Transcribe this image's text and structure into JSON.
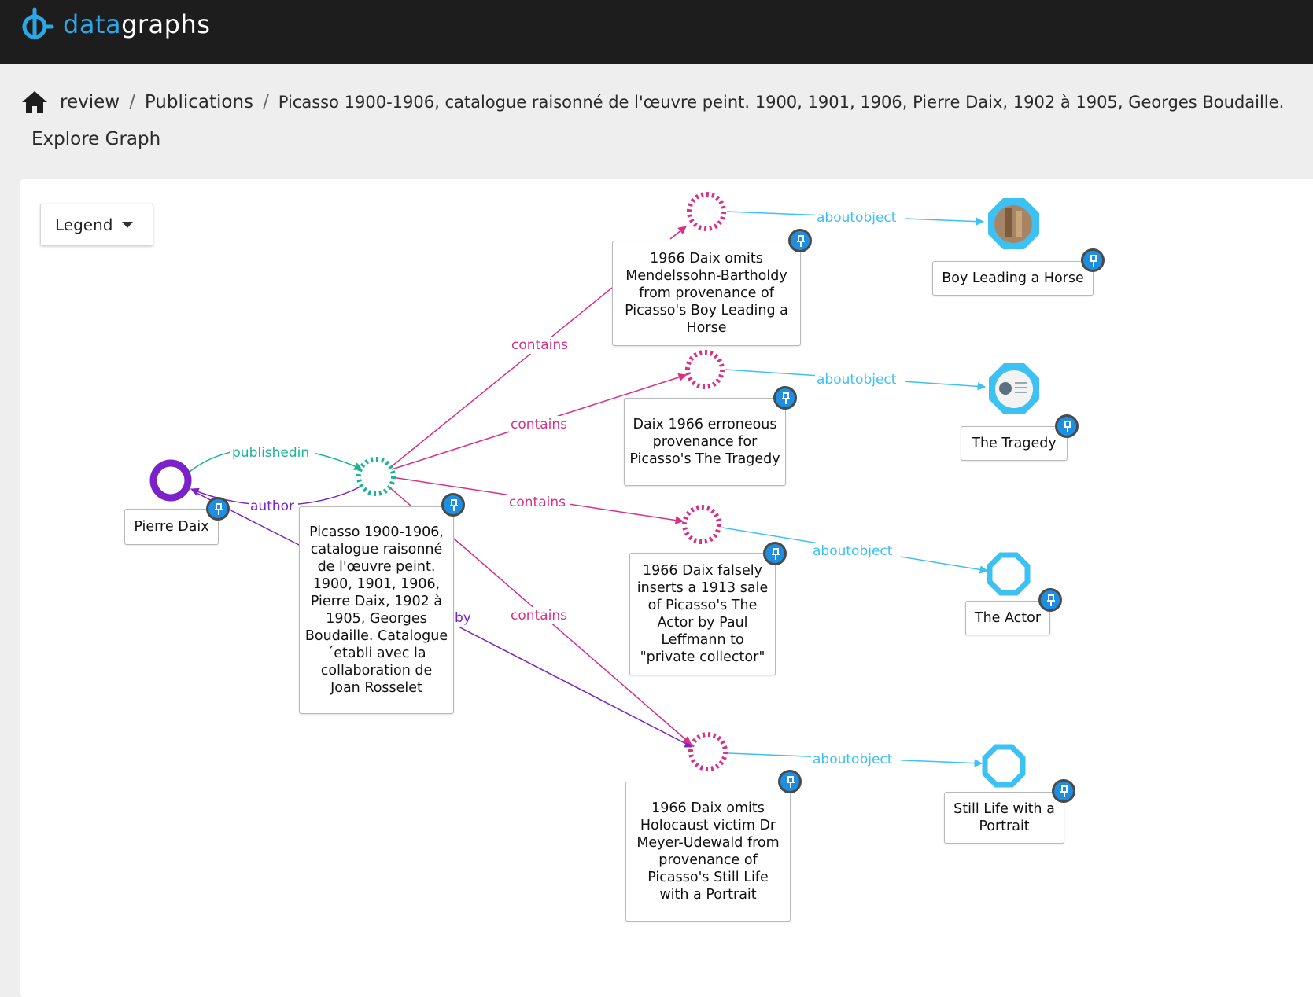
{
  "app": {
    "brand_part1": "data",
    "brand_part2": "graphs"
  },
  "breadcrumb": {
    "items": [
      "review",
      "Publications"
    ],
    "separator": "/",
    "current": "Picasso 1900-1906, catalogue raisonné de l'œuvre peint. 1900, 1901, 1906, Pierre Daix, 1902 à 1905, Georges Boudaille."
  },
  "page": {
    "subtitle": "Explore Graph"
  },
  "legend": {
    "label": "Legend"
  },
  "colors": {
    "contains": "#d92f86",
    "aboutobject": "#3dc1f2",
    "publishedin": "#1ab394",
    "author": "#7a21c9",
    "pin": "#1e8fe0"
  },
  "graph": {
    "nodes": {
      "pierre": {
        "label": "Pierre Daix"
      },
      "publication": {
        "label": "Picasso 1900-1906, catalogue raisonné de l'œuvre peint. 1900, 1901, 1906, Pierre Daix, 1902 à 1905, Georges Boudaille. Catalogue´etabli avec la collaboration de Joan Rosselet"
      },
      "claim1": {
        "label": "1966 Daix omits Mendelssohn-Bartholdy from provenance of Picasso's Boy Leading a Horse"
      },
      "claim2": {
        "label": "Daix 1966 erroneous provenance for Picasso's The Tragedy"
      },
      "claim3": {
        "label": "1966 Daix falsely inserts a 1913 sale of Picasso's The Actor by Paul Leffmann to \"private collector\""
      },
      "claim4": {
        "label": "1966 Daix omits Holocaust victim Dr Meyer-Udewald from provenance of Picasso's Still Life with a Portrait"
      },
      "art1": {
        "label": "Boy Leading a Horse"
      },
      "art2": {
        "label": "The Tragedy"
      },
      "art3": {
        "label": "The Actor"
      },
      "art4": {
        "label": "Still Life with a Portrait"
      }
    },
    "edges": {
      "publishedin": "publishedin",
      "author": "author",
      "by": "by",
      "contains1": "contains",
      "contains2": "contains",
      "contains3": "contains",
      "contains4": "contains",
      "about1": "aboutobject",
      "about2": "aboutobject",
      "about3": "aboutobject",
      "about4": "aboutobject"
    }
  }
}
